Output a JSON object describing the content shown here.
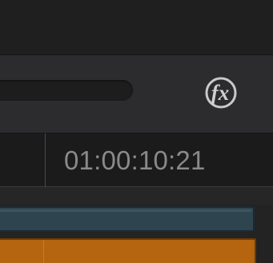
{
  "toolbar": {
    "fx_button": {
      "label": "fx",
      "icon": "fx-icon"
    }
  },
  "timeline": {
    "timecode": "01:00:10:21"
  },
  "colors": {
    "toolbar_bg": "#2c2c2e",
    "ruler_bg": "#1b1b1c",
    "timecode_text": "#8a8a8d",
    "clip_video": "#2e4550",
    "clip_audio": "#b5650f"
  }
}
